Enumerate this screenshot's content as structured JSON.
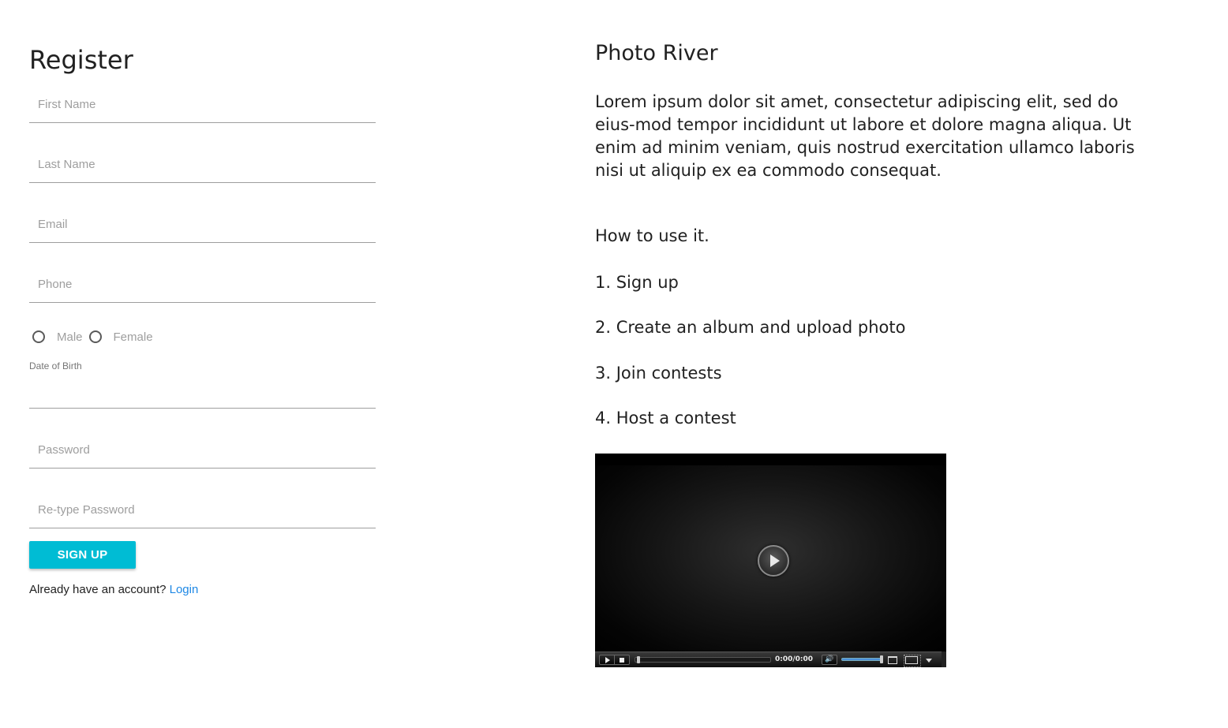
{
  "register": {
    "title": "Register",
    "first_name_placeholder": "First Name",
    "last_name_placeholder": "Last Name",
    "email_placeholder": "Email",
    "phone_placeholder": "Phone",
    "gender_options": [
      "Male",
      "Female"
    ],
    "dob_label": "Date of Birth",
    "password_placeholder": "Password",
    "retype_password_placeholder": "Re-type Password",
    "signup_label": "SIGN UP",
    "login_prompt": "Already have an account?",
    "login_link": "Login"
  },
  "info": {
    "title": "Photo River",
    "description": "Lorem ipsum dolor sit amet, consectetur adipiscing elit, sed do eius-mod tempor incididunt ut labore et dolore magna aliqua. Ut enim ad minim veniam, quis nostrud exercitation ullamco laboris nisi ut aliquip ex ea commodo consequat.",
    "how_to": "How to use it.",
    "steps": [
      "1. Sign up",
      "2. Create an album and upload photo",
      "3. Join contests",
      "4. Host a contest"
    ]
  },
  "video": {
    "time": "0:00/0:00",
    "icons": [
      "play-icon",
      "stop-icon",
      "mute-icon",
      "window-icon",
      "fullscreen-icon",
      "menu-arrow-icon"
    ]
  },
  "colors": {
    "accent": "#00bcd4",
    "link": "#1e88e5",
    "placeholder": "#9e9e9e",
    "underline": "#9e9e9e"
  }
}
